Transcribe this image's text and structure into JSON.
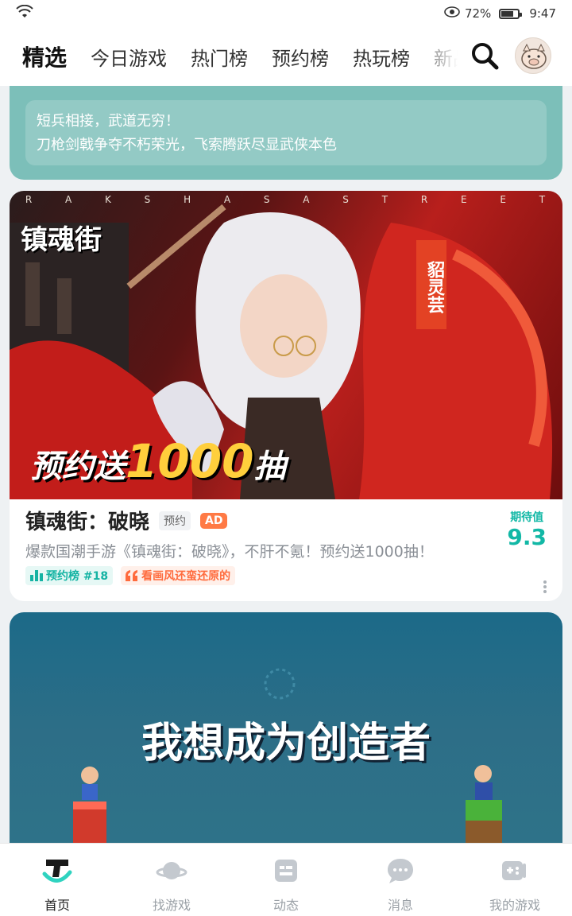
{
  "status_bar": {
    "battery_percent": "72%",
    "time": "9:47"
  },
  "top_nav": {
    "tabs": [
      {
        "label": "精选",
        "active": true
      },
      {
        "label": "今日游戏",
        "active": false
      },
      {
        "label": "热门榜",
        "active": false
      },
      {
        "label": "预约榜",
        "active": false
      },
      {
        "label": "热玩榜",
        "active": false
      },
      {
        "label": "新品",
        "active": false
      }
    ]
  },
  "card_promo": {
    "line1": "短兵相接，武道无穷！",
    "line2": "刀枪剑戟争夺不朽荣光，飞索腾跃尽显武侠本色"
  },
  "card_game": {
    "banner_letters": [
      "R",
      "A",
      "K",
      "S",
      "H",
      "A",
      "S",
      "A",
      "S",
      "T",
      "R",
      "E",
      "E",
      "T"
    ],
    "banner_logo": "镇魂街",
    "banner_tag": "貂灵芸",
    "banner_promo_a": "预约送",
    "banner_promo_b": "1000",
    "banner_promo_c": "抽",
    "title": "镇魂街：破晓",
    "tag_reserve": "预约",
    "tag_ad": "AD",
    "description": "爆款国潮手游《镇魂街：破晓》，不肝不氪！预约送1000抽！",
    "rank_chip": "预约榜 #18",
    "quote_chip": "看画风还蛮还原的",
    "rating_label": "期待值",
    "rating_value": "9.3"
  },
  "card_video": {
    "title": "我想成为创造者"
  },
  "bottom_nav": {
    "items": [
      {
        "label": "首页",
        "active": true
      },
      {
        "label": "找游戏",
        "active": false
      },
      {
        "label": "动态",
        "active": false
      },
      {
        "label": "消息",
        "active": false
      },
      {
        "label": "我的游戏",
        "active": false
      }
    ]
  },
  "colors": {
    "accent": "#2fd3c0",
    "rating": "#12b8a6",
    "ad_tag": "#ff7a45"
  }
}
